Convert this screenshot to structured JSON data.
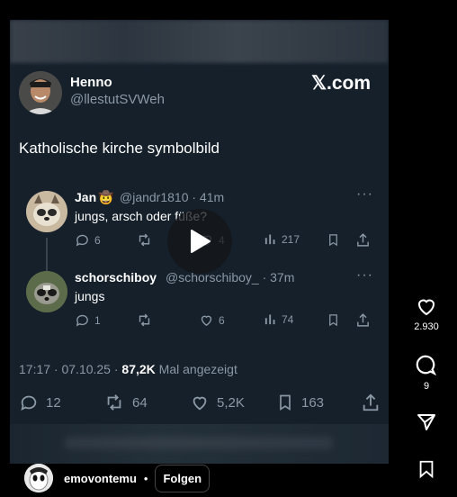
{
  "post": {
    "author_name": "Henno",
    "author_handle": "@llestutSVWeh",
    "source": "𝕏.com",
    "text": "Katholische kirche symbolbild",
    "timestamp": "17:17 · 07.10.25 · ",
    "views_count": "87,2K",
    "views_label": "Mal angezeigt",
    "replies": "12",
    "reposts": "64",
    "likes": "5,2K",
    "bookmarks": "163"
  },
  "replies": [
    {
      "name": "Jan",
      "handle_time": "@jandr1810 · 41m",
      "text": "jungs, arsch oder füße?",
      "comments": "6",
      "likes": "4",
      "views": "217"
    },
    {
      "name": "schorschiboy",
      "handle_time": "@schorschiboy_ · 37m",
      "text": "jungs",
      "comments": "1",
      "likes": "6",
      "views": "74"
    }
  ],
  "sidebar": {
    "likes": "2.930",
    "comments": "9"
  },
  "footer": {
    "username": "emovontemu",
    "separator": "•",
    "follow_label": "Folgen"
  },
  "icons": {
    "like": "heart-icon",
    "comment": "comment-icon",
    "share": "send-icon",
    "save": "bookmark-icon",
    "play": "play-icon"
  }
}
